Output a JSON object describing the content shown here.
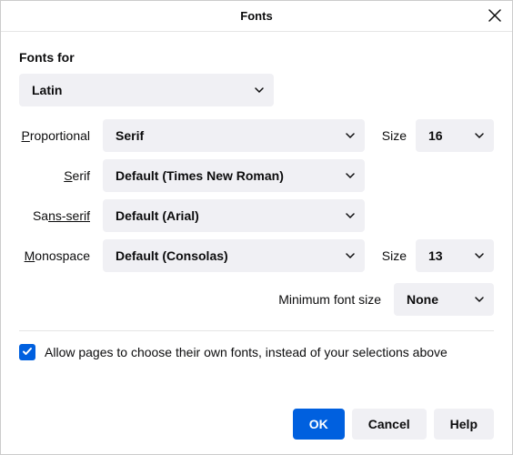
{
  "title": "Fonts",
  "heading": "Fonts for",
  "language": "Latin",
  "labels": {
    "proportional_pre": "P",
    "proportional_post": "roportional",
    "serif_pre": "S",
    "serif_post": "erif",
    "sansserif_pre": "Sa",
    "sansserif_post": "ns-serif",
    "monospace_pre": "M",
    "monospace_post": "onospace",
    "size_pre": "Si",
    "size_post": "ze",
    "minimum_pre": "Minimum f",
    "minimum_post": "ont size",
    "allow_pre": "A",
    "allow_post": "llow pages to choose their own fonts, instead of your selections above",
    "help_pre": "H",
    "help_post": "elp"
  },
  "values": {
    "proportional": "Serif",
    "serif": "Default (Times New Roman)",
    "sansserif": "Default (Arial)",
    "monospace": "Default (Consolas)",
    "prop_size": "16",
    "mono_size": "13",
    "minimum": "None"
  },
  "buttons": {
    "ok": "OK",
    "cancel": "Cancel"
  }
}
